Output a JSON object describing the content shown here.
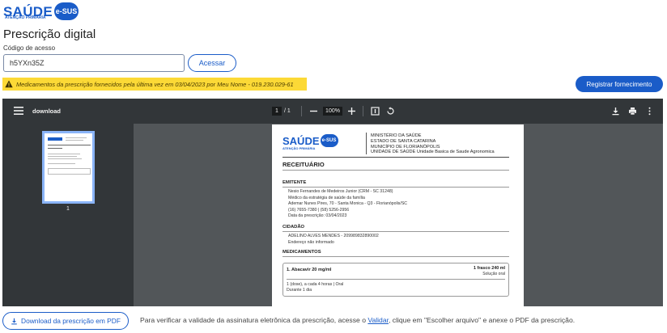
{
  "brand": {
    "name": "SAÚDE",
    "badge": "e-SUS",
    "sub": "ATENÇÃO PRIMÁRIA",
    "color": "#1a5cc8"
  },
  "page": {
    "title": "Prescrição digital"
  },
  "access": {
    "label": "Código de acesso",
    "value": "h5YXn35Z",
    "button": "Acessar"
  },
  "warning": {
    "text": "Medicamentos da prescrição fornecidos pela última vez em 03/04/2023 por Meu Nome - 019.230.029-61",
    "color": "#fcd936"
  },
  "register_button": "Registrar fornecimento",
  "viewer": {
    "doc_name": "download",
    "current_page": "1",
    "page_sep": "/",
    "total_pages": "1",
    "zoom": "100%",
    "thumb_page": "1",
    "icons": [
      "menu-icon",
      "zoom-out-icon",
      "zoom-in-icon",
      "fit-page-icon",
      "rotate-icon",
      "download-icon",
      "print-icon",
      "more-icon"
    ]
  },
  "document": {
    "logo_word": "SAÚDE",
    "logo_badge": "e-SUS",
    "logo_sub": "ATENÇÃO PRIMÁRIA",
    "org": [
      "MINISTÉRIO DA SAÚDE",
      "ESTADO DE SANTA CATARINA",
      "MUNICÍPIO DE FLORIANÓPOLIS",
      "UNIDADE DE SAÚDE Unidade Basica de Saude Agronomica"
    ],
    "title": "RECEITUÁRIO",
    "emitente_label": "EMITENTE",
    "emitente": [
      "Nesio Fernandes de Medeiros Junior (CRM - SC 31248)",
      "Médico da estratégia de saúde da família",
      "Ademar Nunes Pires, 70 - Santa Monica - Q3 - Florianópolis/SC",
      "(16) 7655-7380  |  (58) 5256-2956",
      "Data da prescrição: 03/04/2023"
    ],
    "cidadao_label": "CIDADÃO",
    "cidadao": [
      "ADELINO ALVES MENDES - 209989832890002",
      "Endereço não informado"
    ],
    "medicamentos_label": "MEDICAMENTOS",
    "medicamento": {
      "name": "1. Abacavir 20 mg/ml",
      "qty": "1 frasco 240 ml",
      "form": "Solução oral",
      "dose": "1 (dose), a cada 4 horas | Oral",
      "duration": "Durante 1 dia"
    }
  },
  "download_button": "Download da prescrição em PDF",
  "footer": {
    "before": "Para verificar a validade da assinatura eletrônica da prescrição, acesse o ",
    "link": "Validar",
    "after": ", clique em \"Escolher arquivo\" e anexe o PDF da prescrição."
  }
}
